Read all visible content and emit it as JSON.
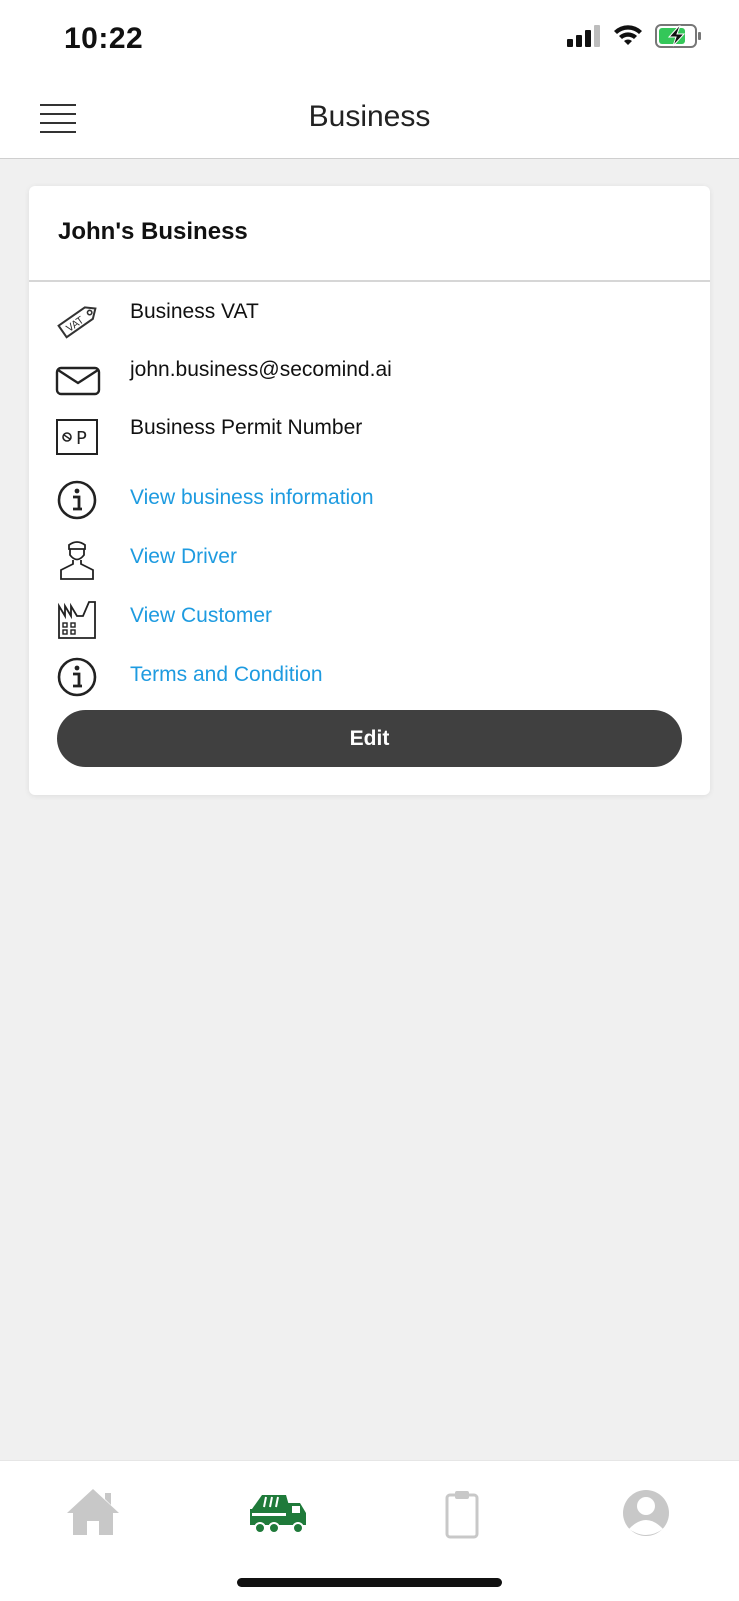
{
  "status_bar": {
    "time": "10:22",
    "icons": [
      "signal-icon",
      "wifi-icon",
      "battery-charging-icon"
    ],
    "battery_color": "#34c759"
  },
  "nav": {
    "title": "Business",
    "menu_icon": "hamburger-menu-icon"
  },
  "card": {
    "title": "John's Business",
    "rows": [
      {
        "icon": "vat-tag-icon",
        "label": "Business VAT",
        "link": false
      },
      {
        "icon": "envelope-icon",
        "label": "john.business@secomind.ai",
        "link": false
      },
      {
        "icon": "parking-permit-icon",
        "label": "Business Permit Number",
        "link": false
      },
      {
        "icon": "info-icon",
        "label": "View business information",
        "link": true
      },
      {
        "icon": "driver-icon",
        "label": "View Driver",
        "link": true
      },
      {
        "icon": "factory-icon",
        "label": "View Customer",
        "link": true
      },
      {
        "icon": "info-icon",
        "label": "Terms and Condition",
        "link": true
      }
    ],
    "edit_label": "Edit"
  },
  "tab_bar": {
    "tabs": [
      {
        "icon": "home-icon",
        "active": false
      },
      {
        "icon": "truck-icon",
        "active": true
      },
      {
        "icon": "clipboard-icon",
        "active": false
      },
      {
        "icon": "profile-icon",
        "active": false
      }
    ],
    "active_color": "#1f7a3a",
    "inactive_color": "#c8c8c8"
  },
  "colors": {
    "link": "#1e9be0",
    "button": "#404040",
    "background": "#f0f0f0"
  }
}
